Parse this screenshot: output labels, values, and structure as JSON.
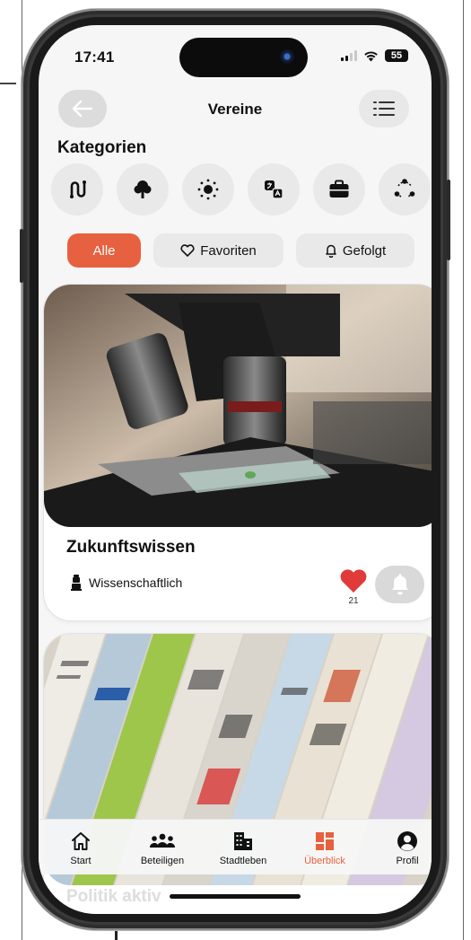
{
  "status_bar": {
    "time": "17:41",
    "battery": "55"
  },
  "header": {
    "title": "Vereine"
  },
  "categories_section": {
    "title": "Kategorien",
    "icons": [
      "route-icon",
      "tree-icon",
      "sun-icon",
      "translate-icon",
      "briefcase-icon",
      "network-icon"
    ]
  },
  "filters": [
    {
      "label": "Alle",
      "active": true
    },
    {
      "label": "Favoriten",
      "icon": "heart-outline-icon",
      "active": false
    },
    {
      "label": "Gefolgt",
      "icon": "bell-outline-icon",
      "active": false
    }
  ],
  "cards": [
    {
      "title": "Zukunftswissen",
      "category": "Wissenschaftlich",
      "category_icon": "microscope-icon",
      "likes": "21",
      "liked": true,
      "image": "microscope-photo"
    },
    {
      "title": "Politik aktiv",
      "image": "newspapers-photo"
    }
  ],
  "tab_bar": {
    "items": [
      {
        "label": "Start",
        "icon": "home-icon",
        "active": false
      },
      {
        "label": "Beteiligen",
        "icon": "people-icon",
        "active": false
      },
      {
        "label": "Stadtleben",
        "icon": "buildings-icon",
        "active": false
      },
      {
        "label": "Überblick",
        "icon": "grid-icon",
        "active": true
      },
      {
        "label": "Profil",
        "icon": "profile-icon",
        "active": false
      }
    ]
  },
  "colors": {
    "accent": "#e7603f",
    "like": "#e03a3a",
    "background": "#f6f6f6"
  }
}
